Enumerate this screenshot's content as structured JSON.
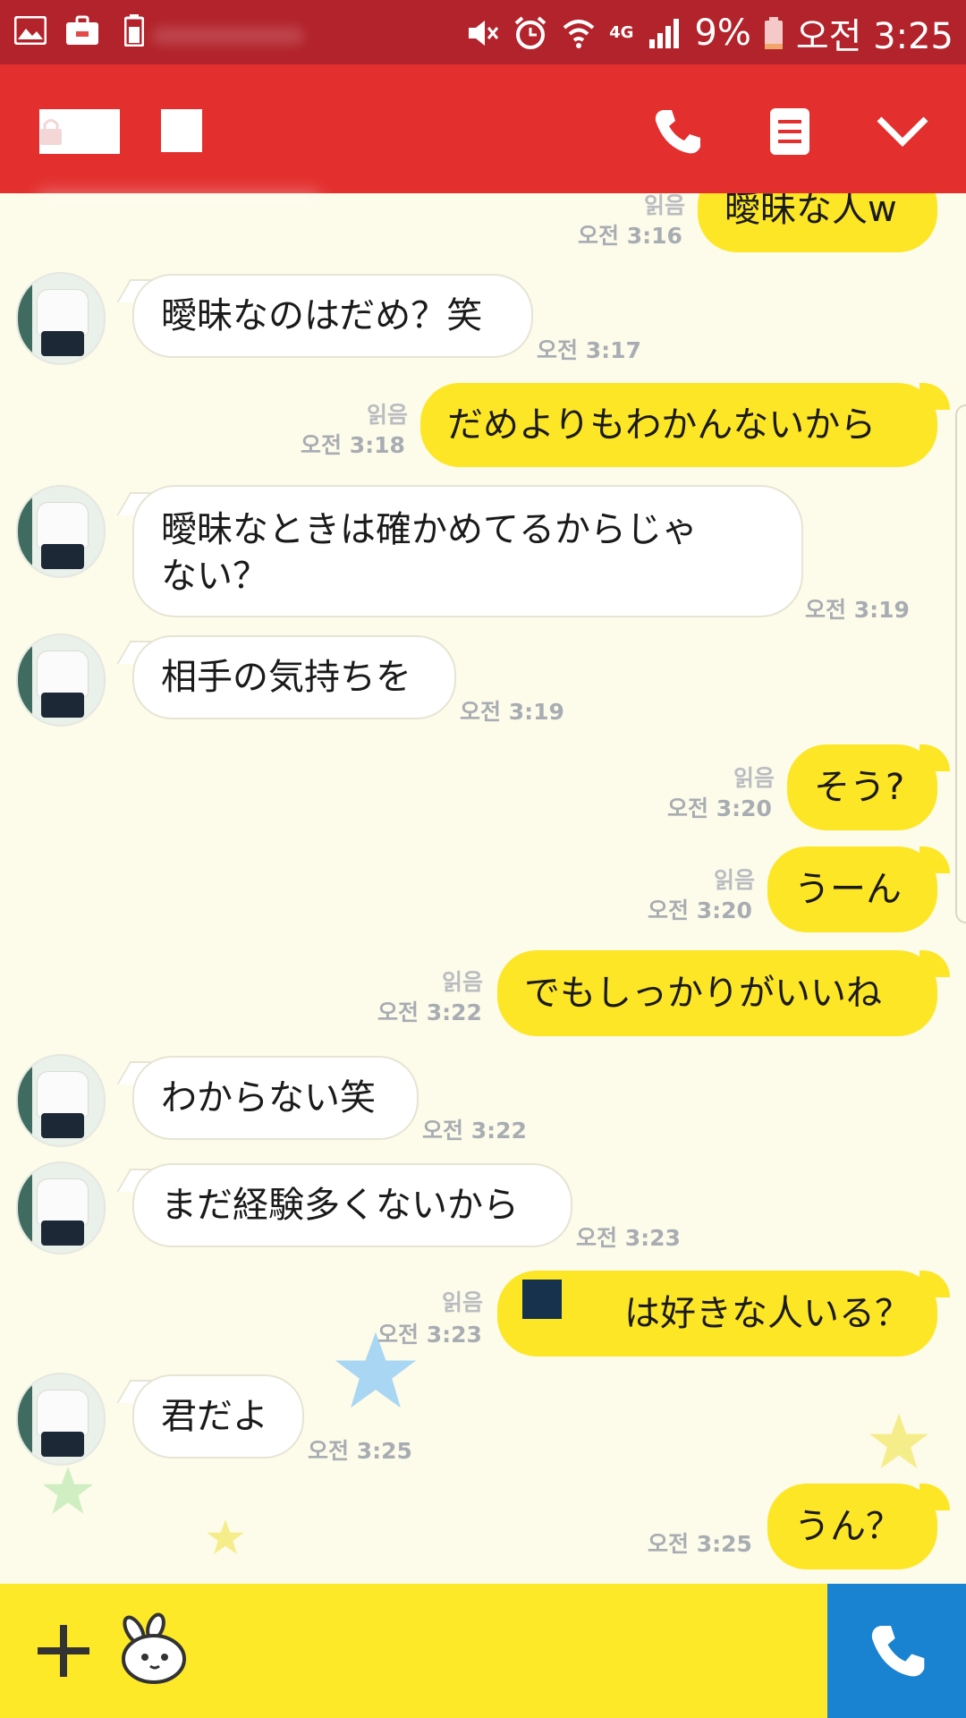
{
  "statusbar": {
    "left_icons": [
      "gallery-icon",
      "au-briefcase-icon",
      "battery-saver-icon"
    ],
    "right_icons": [
      "mute-icon",
      "alarm-icon",
      "wifi-icon",
      "4g-icon",
      "signal-icon"
    ],
    "network": "4G",
    "battery": "9%",
    "time": "오전 3:25"
  },
  "header": {
    "icons": [
      "lock-icon",
      "phone-icon",
      "menu-icon",
      "chevron-down-icon"
    ]
  },
  "messages": [
    {
      "dir": "out",
      "text": "曖昧な人w",
      "read": "읽음",
      "time": "오전 3:16"
    },
    {
      "dir": "in",
      "text": "曖昧なのはだめ？笑",
      "time": "오전 3:17"
    },
    {
      "dir": "out",
      "text": "だめよりもわかんないから",
      "read": "읽음",
      "time": "오전 3:18"
    },
    {
      "dir": "in",
      "line1": "曖昧なときは確かめてるからじゃ",
      "line2": "ない？",
      "time": "오전 3:19"
    },
    {
      "dir": "in",
      "text": "相手の気持ちを",
      "time": "오전 3:19"
    },
    {
      "dir": "out",
      "text": "そう?",
      "read": "읽음",
      "time": "오전 3:20"
    },
    {
      "dir": "out",
      "text": "うーん",
      "read": "읽음",
      "time": "오전 3:20"
    },
    {
      "dir": "out",
      "text": "でもしっかりがいいね",
      "read": "읽음",
      "time": "오전 3:22"
    },
    {
      "dir": "in",
      "text": "わからない笑",
      "time": "오전 3:22"
    },
    {
      "dir": "in",
      "text": "まだ経験多くないから",
      "time": "오전 3:23"
    },
    {
      "dir": "out",
      "text": "は好きな人いる？",
      "read": "읽음",
      "time": "오전 3:23"
    },
    {
      "dir": "in",
      "text": "君だよ",
      "time": "오전 3:25"
    },
    {
      "dir": "out",
      "text": "うん？",
      "time": "오전 3:25"
    }
  ],
  "inputbar": {
    "icons": [
      "plus-icon",
      "emoticon-icon"
    ],
    "call_icon": "phone-icon"
  },
  "colors": {
    "status_bar": "#b3232b",
    "header": "#e3302f",
    "background": "#fdfbe9",
    "out_bubble": "#fde626",
    "in_bubble": "#ffffff",
    "input_bar": "#fde928",
    "call_button": "#1a83d1"
  }
}
